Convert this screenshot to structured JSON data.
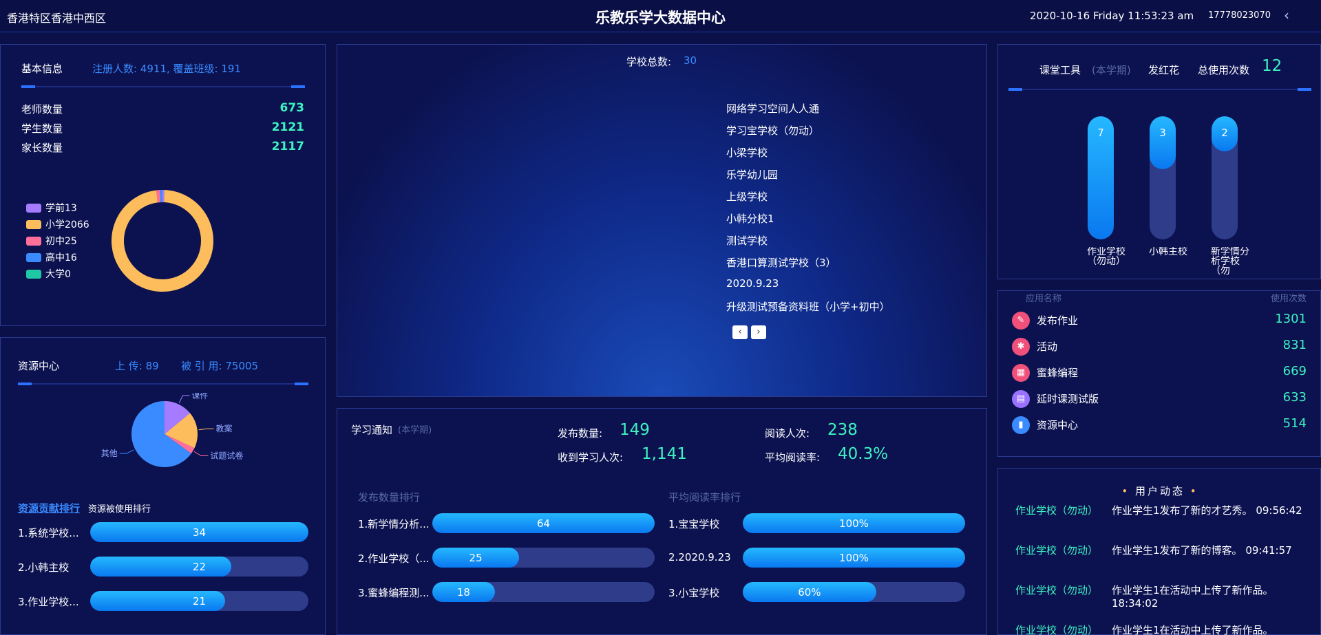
{
  "header": {
    "region": "香港特区香港中西区",
    "title": "乐教乐学大数据中心",
    "datetime": "2020-10-16 Friday 11:53:23 am",
    "user": "17778023070",
    "back_icon": "chevron-left-icon"
  },
  "basic": {
    "title": "基本信息",
    "summary": "注册人数: 4911, 覆盖班级: 191",
    "rows": [
      {
        "label": "老师数量",
        "value": "673"
      },
      {
        "label": "学生数量",
        "value": "2121"
      },
      {
        "label": "家长数量",
        "value": "2117"
      }
    ],
    "legend": [
      {
        "label": "学前13",
        "color": "#a57cff",
        "value": 13
      },
      {
        "label": "小学2066",
        "color": "#fdbd5c",
        "value": 2066
      },
      {
        "label": "初中25",
        "color": "#ff6f9a",
        "value": 25
      },
      {
        "label": "高中16",
        "color": "#3a8bff",
        "value": 16
      },
      {
        "label": "大学0",
        "color": "#20c9a6",
        "value": 0
      }
    ]
  },
  "resource": {
    "title": "资源中心",
    "upload": "上 传: 89",
    "cited": "被 引 用: 75005",
    "pie": [
      {
        "label": "课件",
        "value": 14,
        "color": "#a57cff"
      },
      {
        "label": "教案",
        "value": 18,
        "color": "#fdbd5c"
      },
      {
        "label": "试题试卷",
        "value": 3,
        "color": "#ff6f9a"
      },
      {
        "label": "其他",
        "value": 65,
        "color": "#3a8bff"
      }
    ],
    "tab_active": "资源贡献排行",
    "tab_other": "资源被使用排行",
    "rank": [
      {
        "label": "1.系统学校...",
        "value": 34
      },
      {
        "label": "2.小韩主校",
        "value": 22
      },
      {
        "label": "3.作业学校...",
        "value": 21
      }
    ],
    "rank_max": 34
  },
  "schools": {
    "label": "学校总数:",
    "count": "30",
    "list": [
      "网络学习空间人人通",
      "学习宝学校（勿动）",
      "小梁学校",
      "乐学幼儿园",
      "上级学校",
      "小韩分校1",
      "测试学校",
      "香港口算测试学校（3）",
      "2020.9.23",
      "升级测试预备资料班（小学+初中）"
    ],
    "prev_icon": "chevron-left-icon",
    "next_icon": "chevron-right-icon"
  },
  "notice": {
    "title": "学习通知",
    "term": "(本学期)",
    "publish_label": "发布数量:",
    "publish": "149",
    "read_label": "阅读人次:",
    "read": "238",
    "recv_label": "收到学习人次:",
    "recv": "1,141",
    "rate_label": "平均阅读率:",
    "rate": "40.3%",
    "left_title": "发布数量排行",
    "right_title": "平均阅读率排行",
    "left": [
      {
        "label": "1.新学情分析...",
        "value": 64
      },
      {
        "label": "2.作业学校（...",
        "value": 25
      },
      {
        "label": "3.蜜蜂编程测...",
        "value": 18
      }
    ],
    "left_max": 64,
    "right": [
      {
        "label": "1.宝宝学校",
        "value": "100%",
        "pct": 100
      },
      {
        "label": "2.2020.9.23",
        "value": "100%",
        "pct": 100
      },
      {
        "label": "3.小宝学校",
        "value": "60%",
        "pct": 60
      }
    ]
  },
  "tools": {
    "title": "课堂工具",
    "term": "(本学期)",
    "flower": "发红花",
    "total_label": "总使用次数",
    "total": "12",
    "bars": [
      {
        "value": 7,
        "label": "作业学校（勿动）"
      },
      {
        "value": 3,
        "label": "小韩主校"
      },
      {
        "value": 2,
        "label": "新学情分析学校（勿"
      }
    ],
    "bar_max": 7
  },
  "apps": {
    "col_name": "应用名称",
    "col_count": "使用次数",
    "items": [
      {
        "name": "发布作业",
        "count": "1301",
        "color": "#f0507a",
        "icon": "homework-icon"
      },
      {
        "name": "活动",
        "count": "831",
        "color": "#f0507a",
        "icon": "pinwheel-icon"
      },
      {
        "name": "蜜蜂编程",
        "count": "669",
        "color": "#f0507a",
        "icon": "grid-icon"
      },
      {
        "name": "延时课测试版",
        "count": "633",
        "color": "#9a72ff",
        "icon": "book-icon"
      },
      {
        "name": "资源中心",
        "count": "514",
        "color": "#3a8bff",
        "icon": "folder-icon"
      }
    ]
  },
  "feed": {
    "title": "用户动态",
    "items": [
      {
        "school": "作业学校（勿动）",
        "text": "作业学生1发布了新的才艺秀。",
        "time": "09:56:42"
      },
      {
        "school": "作业学校（勿动）",
        "text": "作业学生1发布了新的博客。",
        "time": "09:41:57"
      },
      {
        "school": "作业学校（勿动）",
        "text": "作业学生1在活动中上传了新作品。",
        "time": "18:34:02"
      },
      {
        "school": "作业学校（勿动）",
        "text": "作业学生1在活动中上传了新作品。",
        "time": ""
      }
    ]
  }
}
